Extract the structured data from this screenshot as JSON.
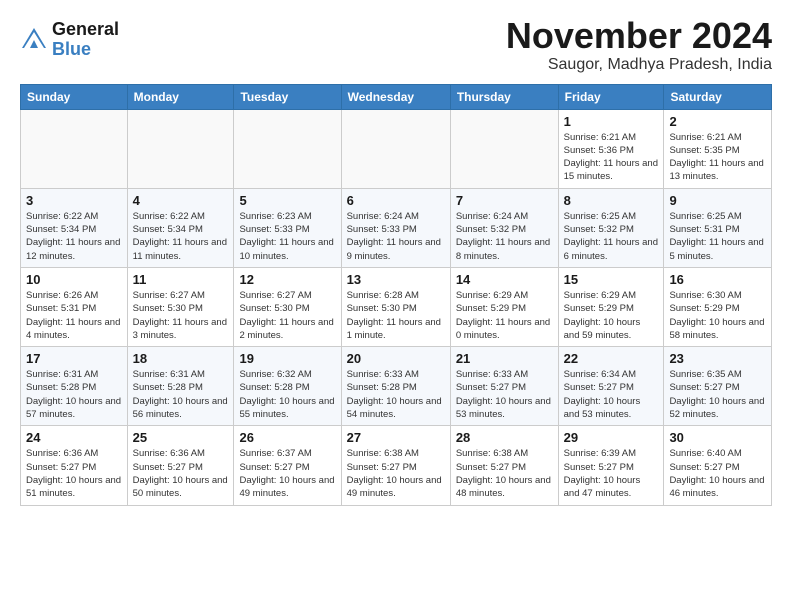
{
  "header": {
    "logo_line1": "General",
    "logo_line2": "Blue",
    "month": "November 2024",
    "location": "Saugor, Madhya Pradesh, India"
  },
  "weekdays": [
    "Sunday",
    "Monday",
    "Tuesday",
    "Wednesday",
    "Thursday",
    "Friday",
    "Saturday"
  ],
  "weeks": [
    [
      {
        "day": "",
        "info": ""
      },
      {
        "day": "",
        "info": ""
      },
      {
        "day": "",
        "info": ""
      },
      {
        "day": "",
        "info": ""
      },
      {
        "day": "",
        "info": ""
      },
      {
        "day": "1",
        "info": "Sunrise: 6:21 AM\nSunset: 5:36 PM\nDaylight: 11 hours\nand 15 minutes."
      },
      {
        "day": "2",
        "info": "Sunrise: 6:21 AM\nSunset: 5:35 PM\nDaylight: 11 hours\nand 13 minutes."
      }
    ],
    [
      {
        "day": "3",
        "info": "Sunrise: 6:22 AM\nSunset: 5:34 PM\nDaylight: 11 hours\nand 12 minutes."
      },
      {
        "day": "4",
        "info": "Sunrise: 6:22 AM\nSunset: 5:34 PM\nDaylight: 11 hours\nand 11 minutes."
      },
      {
        "day": "5",
        "info": "Sunrise: 6:23 AM\nSunset: 5:33 PM\nDaylight: 11 hours\nand 10 minutes."
      },
      {
        "day": "6",
        "info": "Sunrise: 6:24 AM\nSunset: 5:33 PM\nDaylight: 11 hours\nand 9 minutes."
      },
      {
        "day": "7",
        "info": "Sunrise: 6:24 AM\nSunset: 5:32 PM\nDaylight: 11 hours\nand 8 minutes."
      },
      {
        "day": "8",
        "info": "Sunrise: 6:25 AM\nSunset: 5:32 PM\nDaylight: 11 hours\nand 6 minutes."
      },
      {
        "day": "9",
        "info": "Sunrise: 6:25 AM\nSunset: 5:31 PM\nDaylight: 11 hours\nand 5 minutes."
      }
    ],
    [
      {
        "day": "10",
        "info": "Sunrise: 6:26 AM\nSunset: 5:31 PM\nDaylight: 11 hours\nand 4 minutes."
      },
      {
        "day": "11",
        "info": "Sunrise: 6:27 AM\nSunset: 5:30 PM\nDaylight: 11 hours\nand 3 minutes."
      },
      {
        "day": "12",
        "info": "Sunrise: 6:27 AM\nSunset: 5:30 PM\nDaylight: 11 hours\nand 2 minutes."
      },
      {
        "day": "13",
        "info": "Sunrise: 6:28 AM\nSunset: 5:30 PM\nDaylight: 11 hours\nand 1 minute."
      },
      {
        "day": "14",
        "info": "Sunrise: 6:29 AM\nSunset: 5:29 PM\nDaylight: 11 hours\nand 0 minutes."
      },
      {
        "day": "15",
        "info": "Sunrise: 6:29 AM\nSunset: 5:29 PM\nDaylight: 10 hours\nand 59 minutes."
      },
      {
        "day": "16",
        "info": "Sunrise: 6:30 AM\nSunset: 5:29 PM\nDaylight: 10 hours\nand 58 minutes."
      }
    ],
    [
      {
        "day": "17",
        "info": "Sunrise: 6:31 AM\nSunset: 5:28 PM\nDaylight: 10 hours\nand 57 minutes."
      },
      {
        "day": "18",
        "info": "Sunrise: 6:31 AM\nSunset: 5:28 PM\nDaylight: 10 hours\nand 56 minutes."
      },
      {
        "day": "19",
        "info": "Sunrise: 6:32 AM\nSunset: 5:28 PM\nDaylight: 10 hours\nand 55 minutes."
      },
      {
        "day": "20",
        "info": "Sunrise: 6:33 AM\nSunset: 5:28 PM\nDaylight: 10 hours\nand 54 minutes."
      },
      {
        "day": "21",
        "info": "Sunrise: 6:33 AM\nSunset: 5:27 PM\nDaylight: 10 hours\nand 53 minutes."
      },
      {
        "day": "22",
        "info": "Sunrise: 6:34 AM\nSunset: 5:27 PM\nDaylight: 10 hours\nand 53 minutes."
      },
      {
        "day": "23",
        "info": "Sunrise: 6:35 AM\nSunset: 5:27 PM\nDaylight: 10 hours\nand 52 minutes."
      }
    ],
    [
      {
        "day": "24",
        "info": "Sunrise: 6:36 AM\nSunset: 5:27 PM\nDaylight: 10 hours\nand 51 minutes."
      },
      {
        "day": "25",
        "info": "Sunrise: 6:36 AM\nSunset: 5:27 PM\nDaylight: 10 hours\nand 50 minutes."
      },
      {
        "day": "26",
        "info": "Sunrise: 6:37 AM\nSunset: 5:27 PM\nDaylight: 10 hours\nand 49 minutes."
      },
      {
        "day": "27",
        "info": "Sunrise: 6:38 AM\nSunset: 5:27 PM\nDaylight: 10 hours\nand 49 minutes."
      },
      {
        "day": "28",
        "info": "Sunrise: 6:38 AM\nSunset: 5:27 PM\nDaylight: 10 hours\nand 48 minutes."
      },
      {
        "day": "29",
        "info": "Sunrise: 6:39 AM\nSunset: 5:27 PM\nDaylight: 10 hours\nand 47 minutes."
      },
      {
        "day": "30",
        "info": "Sunrise: 6:40 AM\nSunset: 5:27 PM\nDaylight: 10 hours\nand 46 minutes."
      }
    ]
  ]
}
